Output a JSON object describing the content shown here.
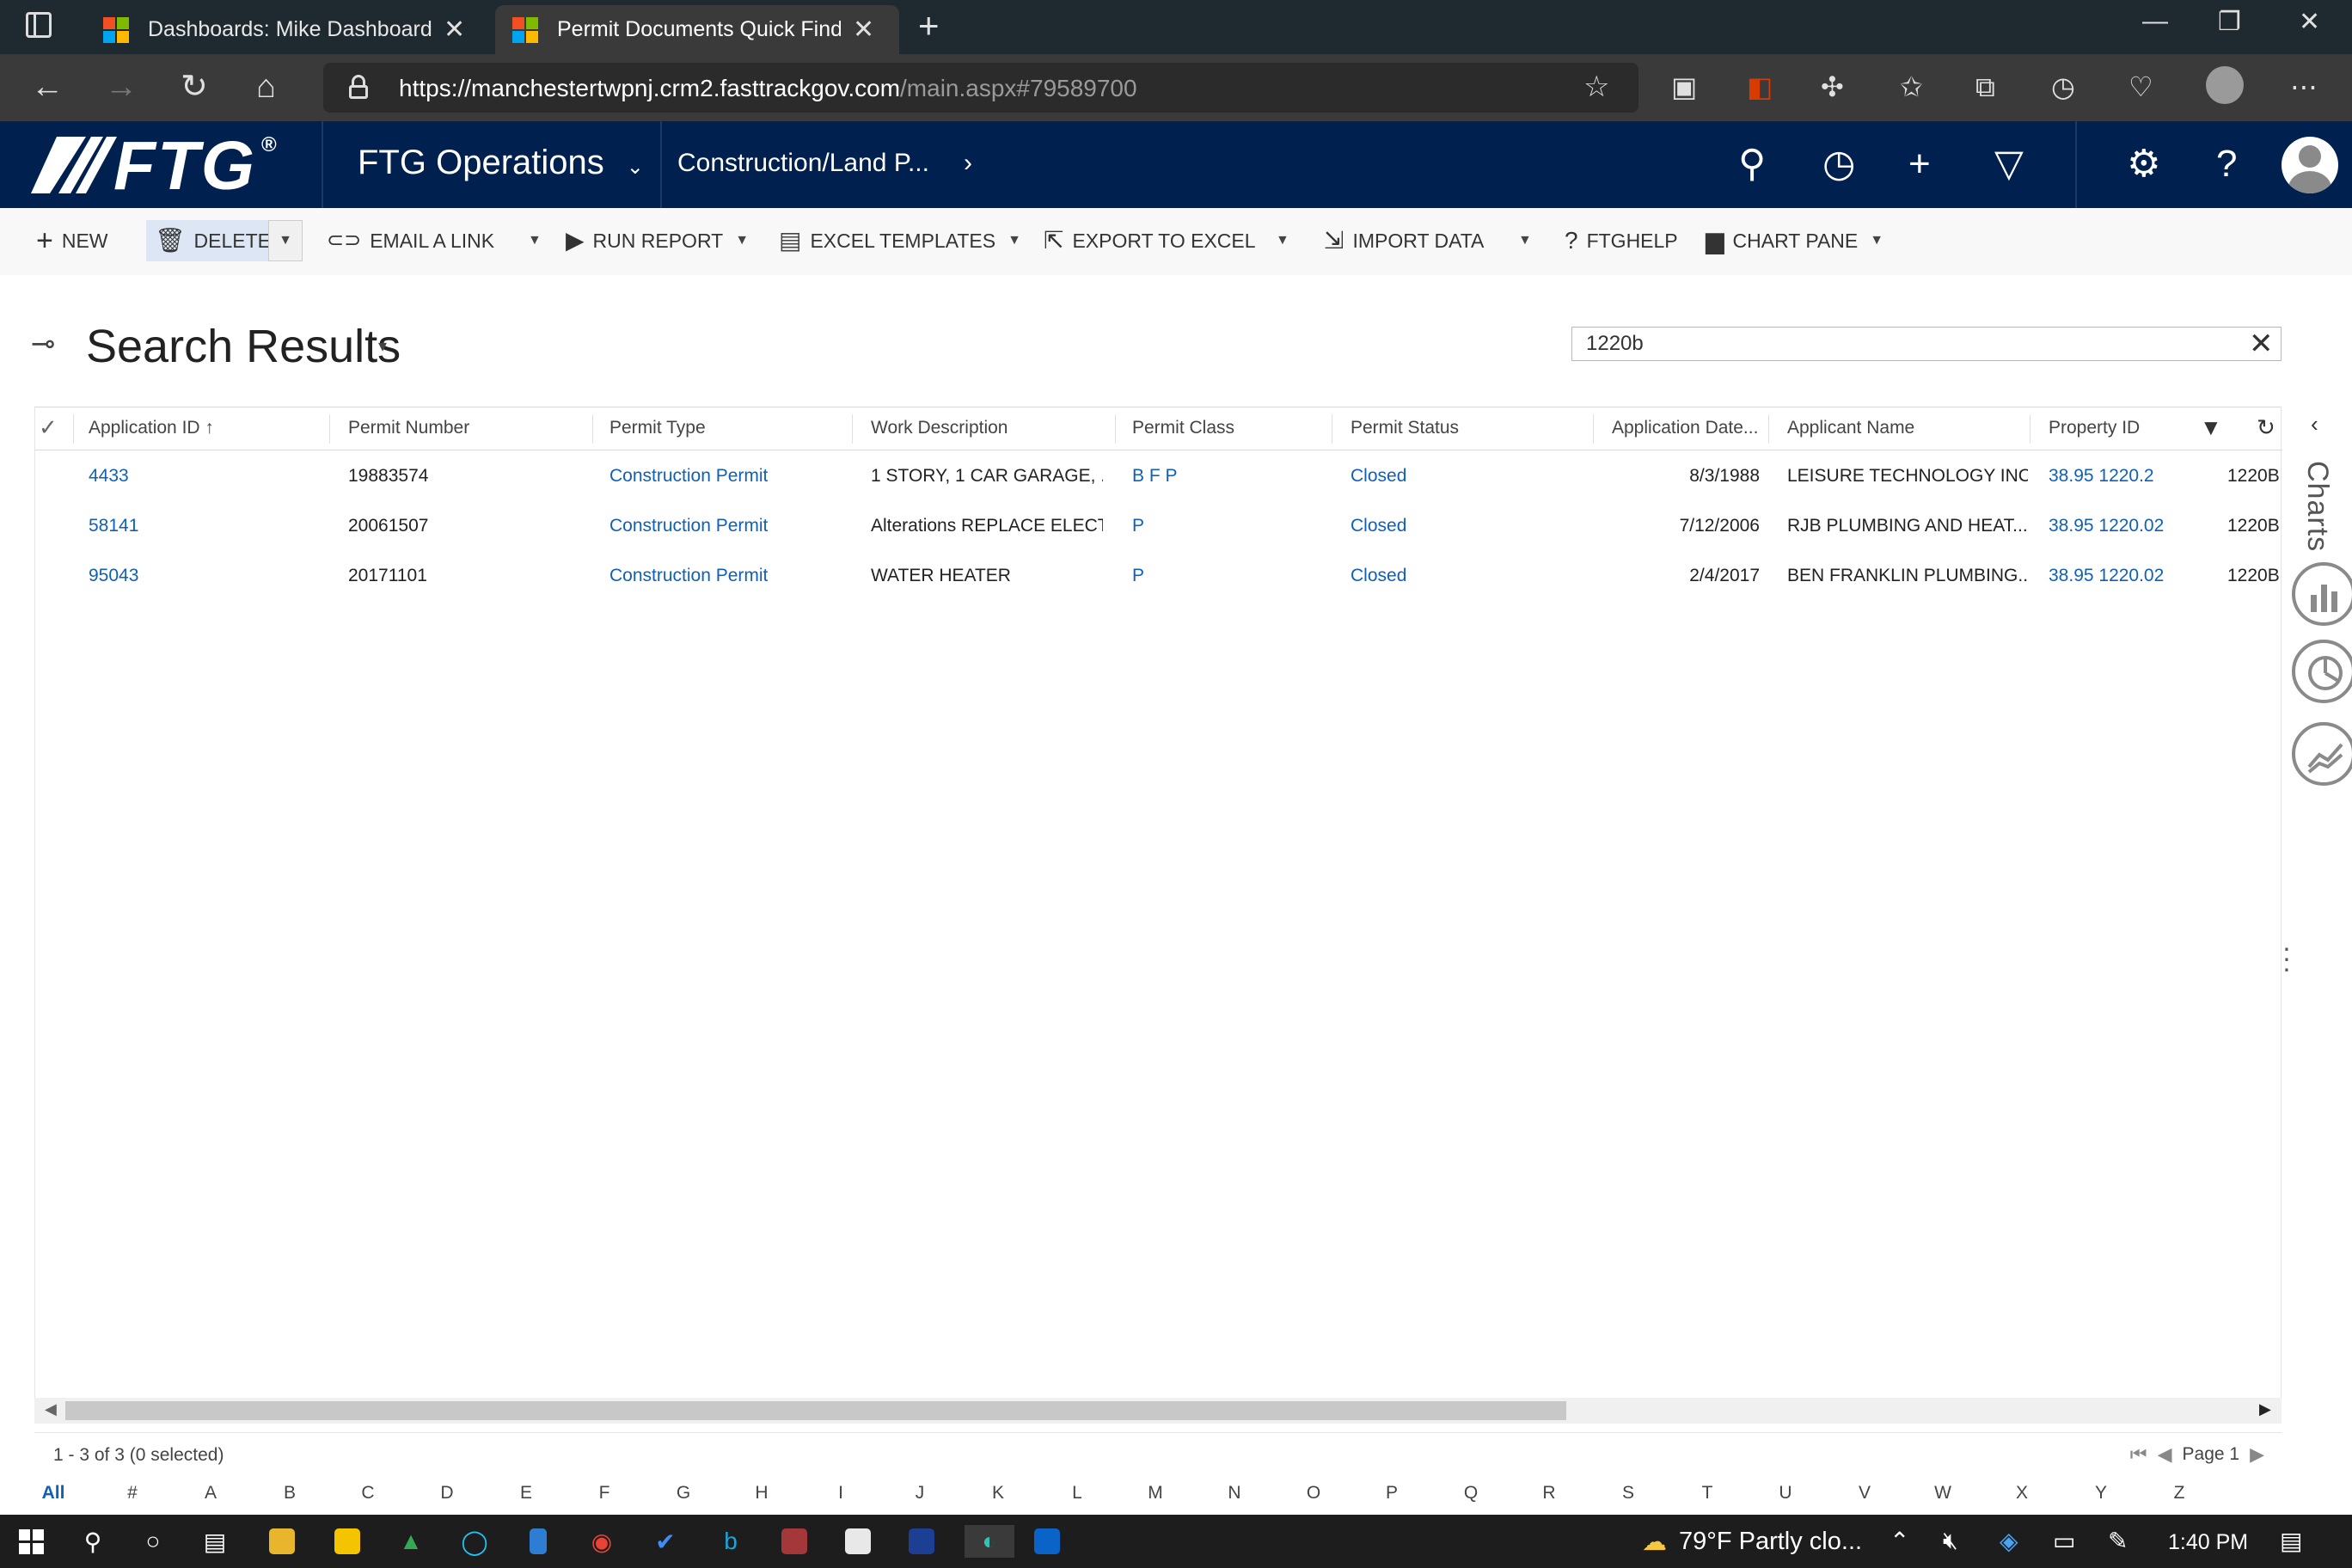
{
  "browser": {
    "tabs": [
      {
        "title": "Dashboards: Mike Dashboard - M",
        "active": false
      },
      {
        "title": "Permit Documents Quick Find Ac",
        "active": true
      }
    ],
    "new_tab_glyph": "+",
    "window_buttons": [
      "—",
      "❐",
      "✕"
    ],
    "url_host": "https://manchestertwpnj.crm2.fasttrackgov.com",
    "url_path": "/main.aspx#79589700"
  },
  "app": {
    "logo": "FTG",
    "logo_mark": "®",
    "area_name": "FTG Operations",
    "breadcrumb": "Construction/Land P...",
    "colors": {
      "header": "#002050",
      "link": "#1160b7",
      "command_bar": "#f8f8f8"
    }
  },
  "commands": [
    {
      "label": "NEW",
      "icon": "plus-icon"
    },
    {
      "label": "DELETE",
      "icon": "trash-icon"
    },
    {
      "label": "EMAIL A LINK",
      "icon": "link-icon"
    },
    {
      "label": "RUN REPORT",
      "icon": "report-icon"
    },
    {
      "label": "EXCEL TEMPLATES",
      "icon": "excel-icon"
    },
    {
      "label": "EXPORT TO EXCEL",
      "icon": "export-icon"
    },
    {
      "label": "IMPORT DATA",
      "icon": "import-icon"
    },
    {
      "label": "FTGHELP",
      "icon": "question-icon"
    },
    {
      "label": "CHART PANE",
      "icon": "bar-chart-icon"
    }
  ],
  "page": {
    "title": "Search Results",
    "search_value": "1220b"
  },
  "grid": {
    "columns": [
      "Application ID",
      "Permit Number",
      "Permit Type",
      "Work Description",
      "Permit Class",
      "Permit Status",
      "Application Date...",
      "Applicant Name",
      "Property ID"
    ],
    "sort_indicator": "↑",
    "rows": [
      {
        "app_id": "4433",
        "permit_number": "19883574",
        "permit_type": "Construction Permit",
        "work_description": "1 STORY, 1 CAR GARAGE, ...",
        "permit_class": "B F P",
        "permit_status": "Closed",
        "app_date": "8/3/1988",
        "applicant": "LEISURE TECHNOLOGY INC",
        "property_id": "38.95 1220.2",
        "extra": "1220B"
      },
      {
        "app_id": "58141",
        "permit_number": "20061507",
        "permit_type": "Construction Permit",
        "work_description": "Alterations REPLACE ELECT...",
        "permit_class": "P",
        "permit_status": "Closed",
        "app_date": "7/12/2006",
        "applicant": "RJB PLUMBING AND HEAT...",
        "property_id": "38.95 1220.02",
        "extra": "1220B"
      },
      {
        "app_id": "95043",
        "permit_number": "20171101",
        "permit_type": "Construction Permit",
        "work_description": "WATER HEATER",
        "permit_class": "P",
        "permit_status": "Closed",
        "app_date": "2/4/2017",
        "applicant": "BEN FRANKLIN PLUMBING...",
        "property_id": "38.95 1220.02",
        "extra": "1220B"
      }
    ],
    "record_count": "1 - 3 of 3 (0 selected)",
    "page_label": "Page 1",
    "alphabet": [
      "All",
      "#",
      "A",
      "B",
      "C",
      "D",
      "E",
      "F",
      "G",
      "H",
      "I",
      "J",
      "K",
      "L",
      "M",
      "N",
      "O",
      "P",
      "Q",
      "R",
      "S",
      "T",
      "U",
      "V",
      "W",
      "X",
      "Y",
      "Z"
    ]
  },
  "side_panel": {
    "label": "Charts"
  },
  "taskbar": {
    "weather": "79°F  Partly clo...",
    "time": "1:40 PM"
  }
}
